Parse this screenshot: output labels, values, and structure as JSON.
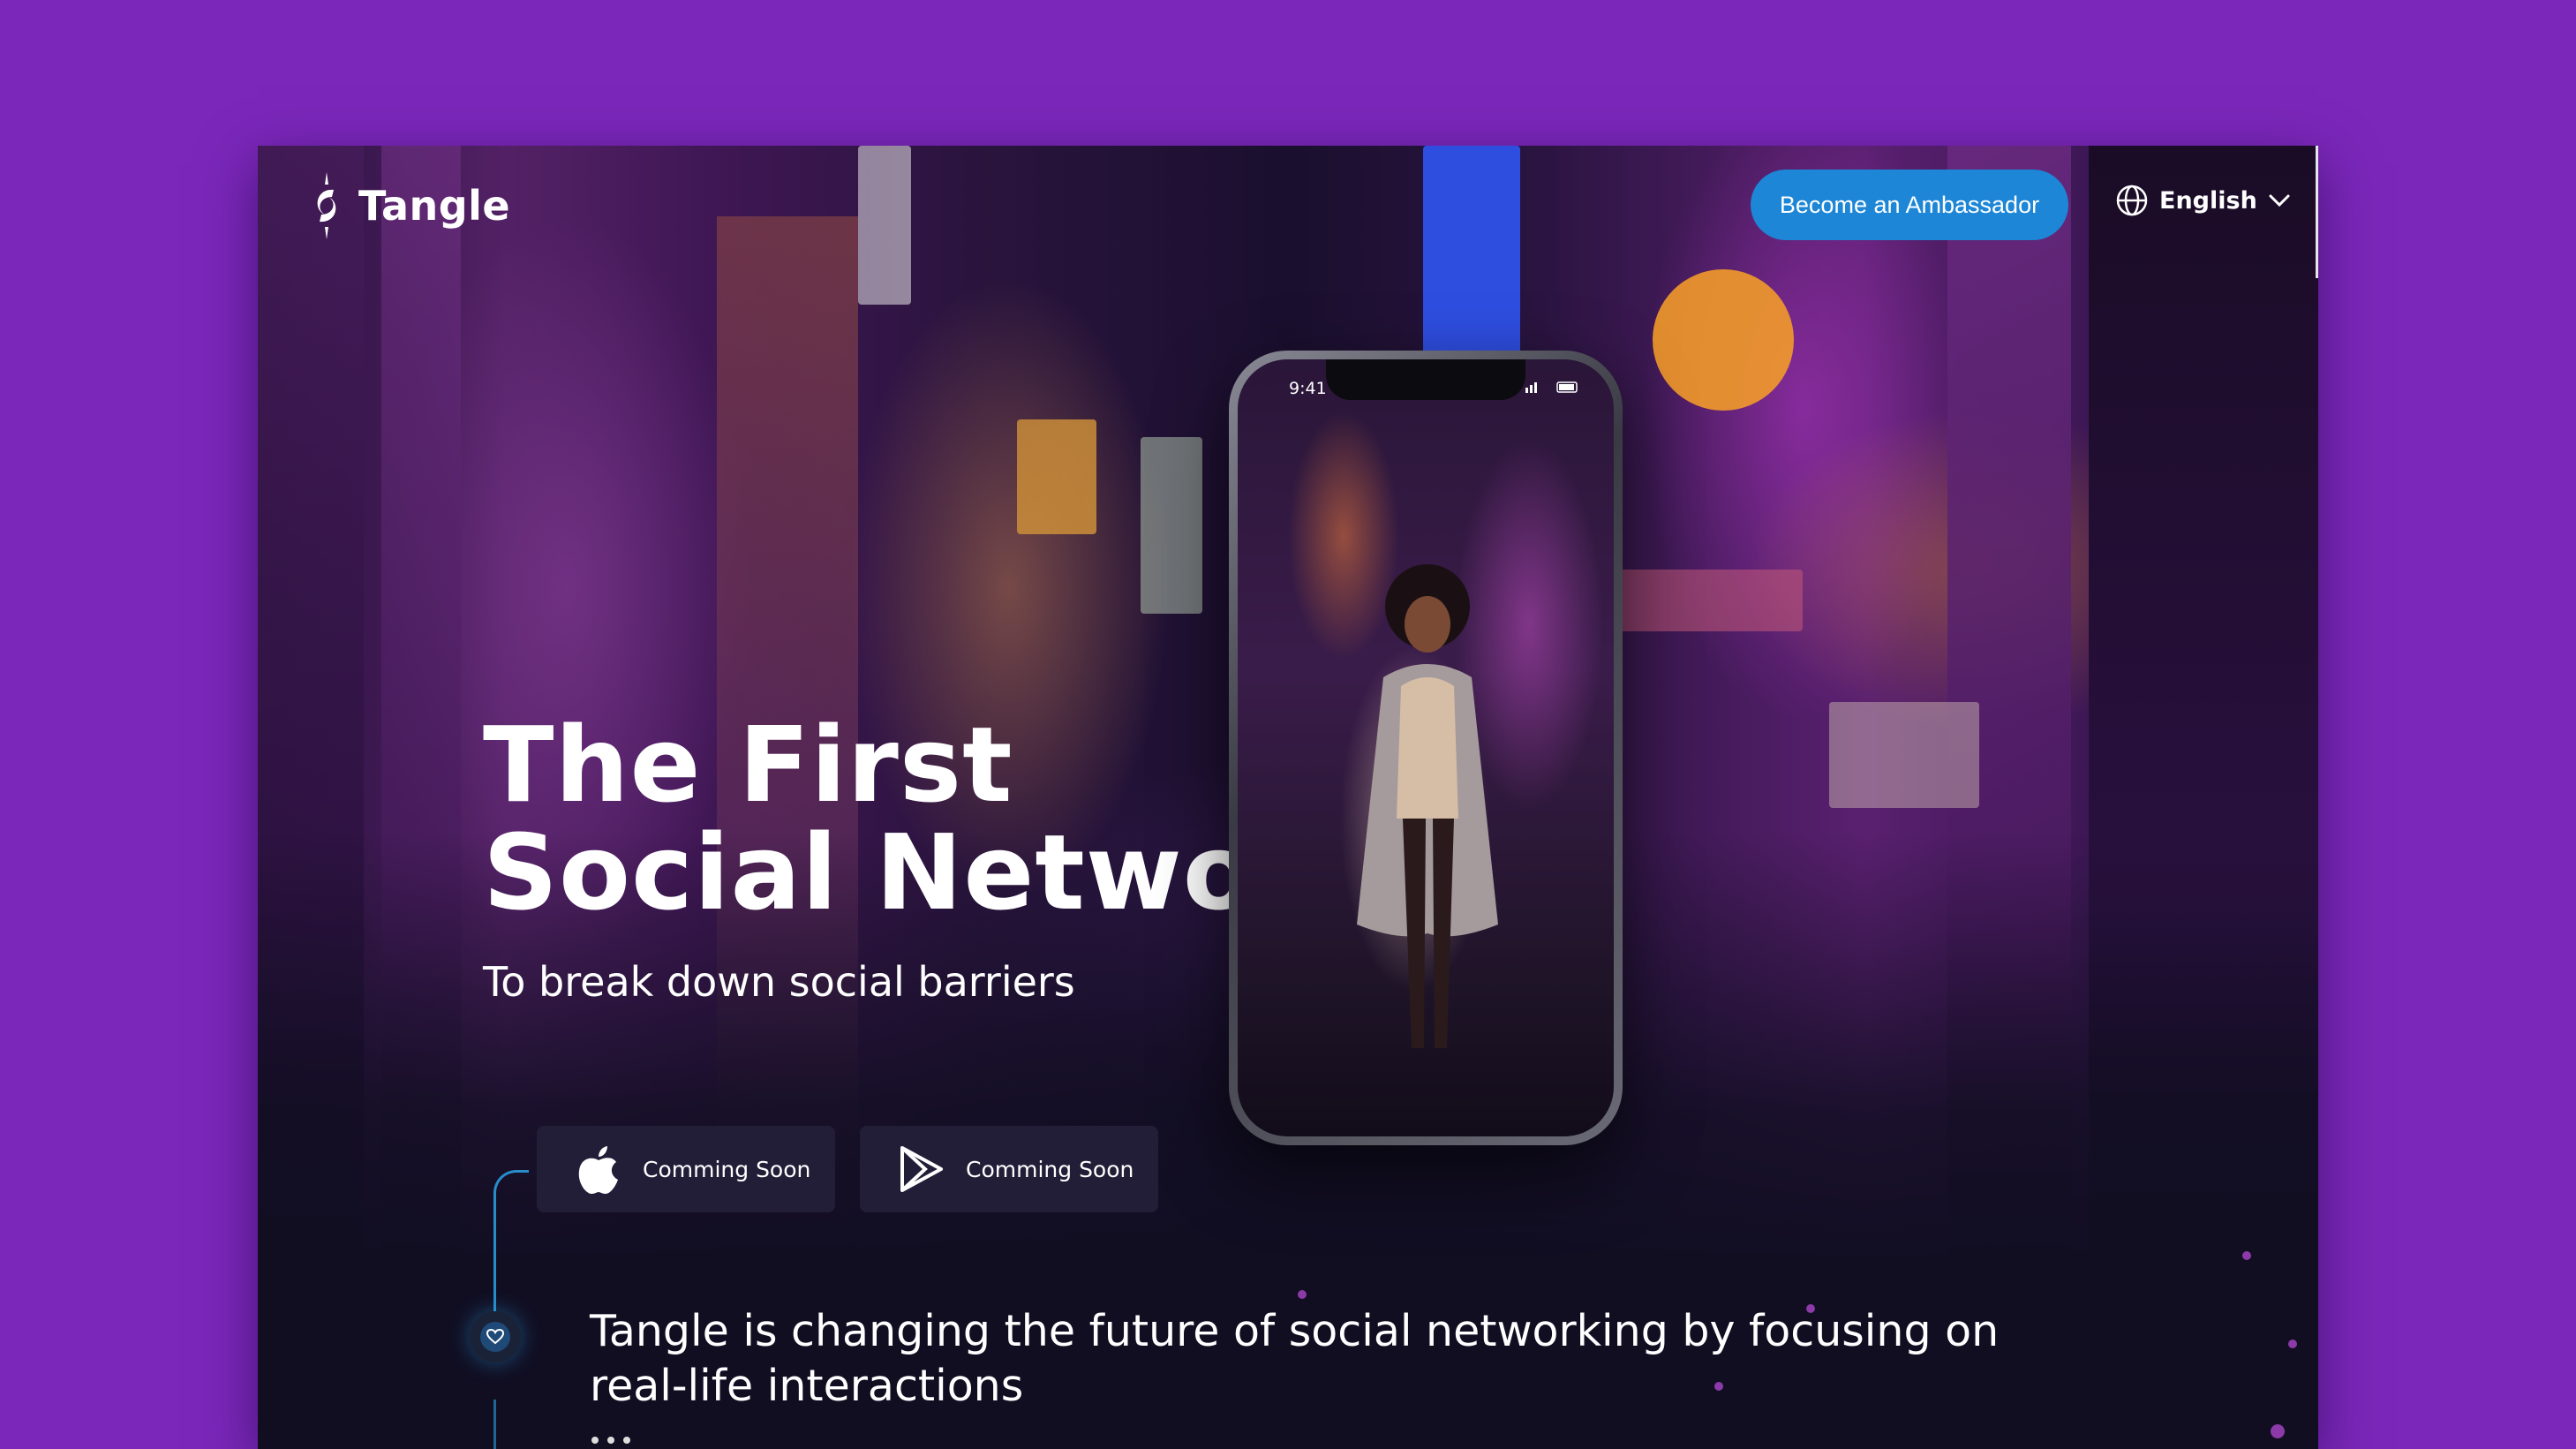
{
  "brand": {
    "name": "Tangle"
  },
  "header": {
    "ambassador_label": "Become an Ambassador",
    "language_label": "English"
  },
  "hero": {
    "title_line1": "The First",
    "title_line2": "Social Network",
    "subtitle": "To break down social barriers"
  },
  "phone": {
    "time": "9:41"
  },
  "stores": [
    {
      "icon": "apple-icon",
      "label": "Comming Soon"
    },
    {
      "icon": "google-play-icon",
      "label": "Comming Soon"
    }
  ],
  "mission": {
    "text": "Tangle is changing the future of social networking by focusing on real-life interactions",
    "icon": "heart-icon"
  },
  "colors": {
    "page_background": "#7b27ba",
    "accent_blue": "#1d86d6",
    "timeline_blue": "#2aa3e8",
    "dark_panel": "#110e22"
  }
}
